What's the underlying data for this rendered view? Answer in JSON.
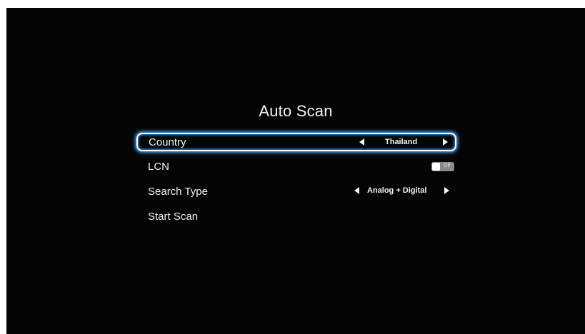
{
  "title": "Auto Scan",
  "colors": {
    "background": "#050505",
    "text": "#f0f0f0",
    "focus_glow": "#3e9ef0",
    "toggle_off": "#8a8a8a"
  },
  "menu": {
    "country": {
      "label": "Country",
      "value": "Thailand",
      "focused": true
    },
    "lcn": {
      "label": "LCN",
      "toggle_text": "Off",
      "state": "off"
    },
    "search_type": {
      "label": "Search Type",
      "value": "Analog + Digital"
    },
    "start_scan": {
      "label": "Start Scan"
    }
  },
  "icons": {
    "left": "arrow-left-icon",
    "right": "arrow-right-icon"
  }
}
